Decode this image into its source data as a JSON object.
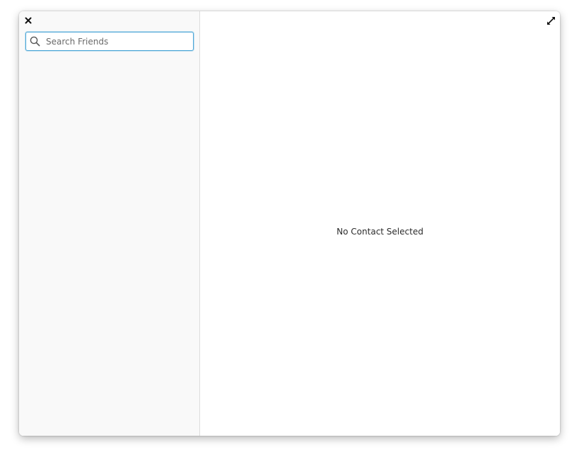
{
  "sidebar": {
    "close_icon": "close-icon",
    "search": {
      "placeholder": "Search Friends",
      "value": "",
      "icon": "search-icon"
    }
  },
  "main": {
    "expand_icon": "expand-icon",
    "empty_message": "No Contact Selected"
  },
  "colors": {
    "sidebar_bg": "#f9f9f9",
    "search_focus_border": "#4fa8d8",
    "text": "#2b2b2b"
  }
}
